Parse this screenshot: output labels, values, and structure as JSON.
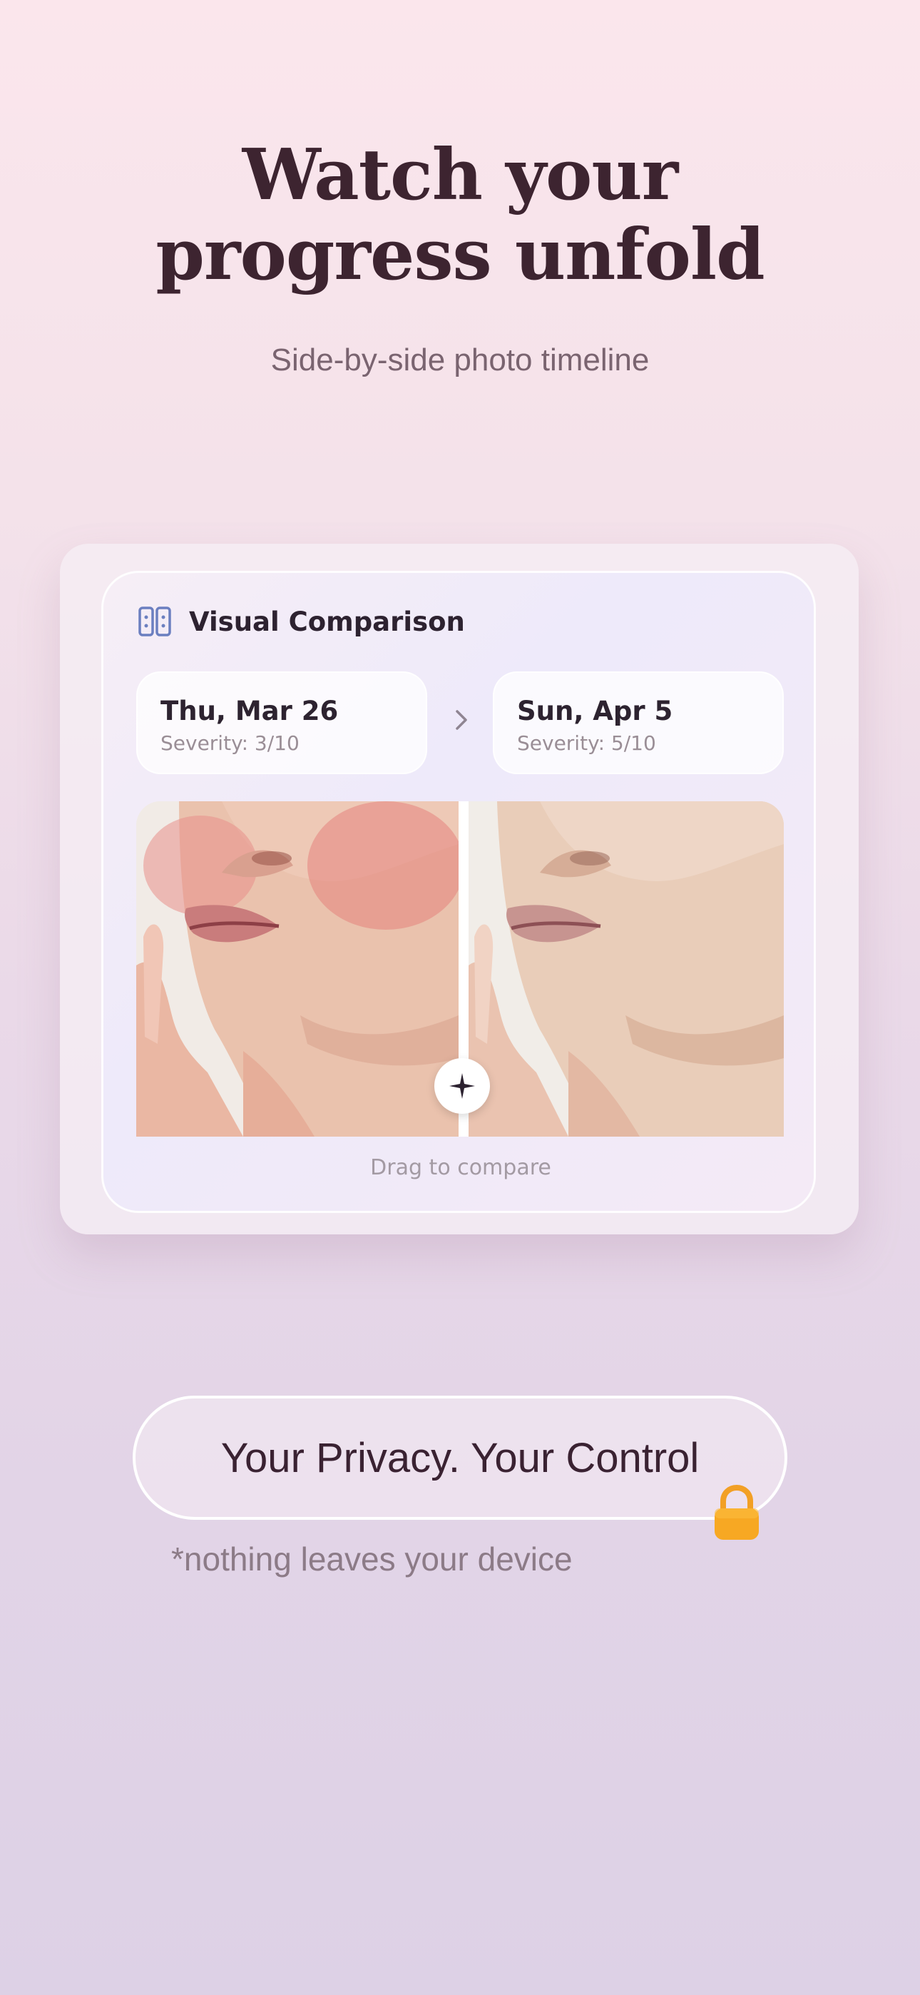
{
  "headline": {
    "line1": "Watch your",
    "line2": "progress unfold"
  },
  "subtitle": "Side-by-side photo timeline",
  "comparison": {
    "title": "Visual Comparison",
    "icon": "compare-columns-icon",
    "before": {
      "date": "Thu, Mar 26",
      "severity": "Severity: 3/10"
    },
    "after": {
      "date": "Sun, Apr 5",
      "severity": "Severity: 5/10"
    },
    "drag_hint": "Drag to compare",
    "handle_icon": "sparkle-icon"
  },
  "privacy": {
    "button_label": "Your Privacy. Your Control",
    "icon": "lock-icon",
    "footnote": "*nothing leaves your device"
  },
  "colors": {
    "title_text": "#3d2430",
    "accent_icon": "#6b7fc0",
    "lock": "#f7a823"
  }
}
